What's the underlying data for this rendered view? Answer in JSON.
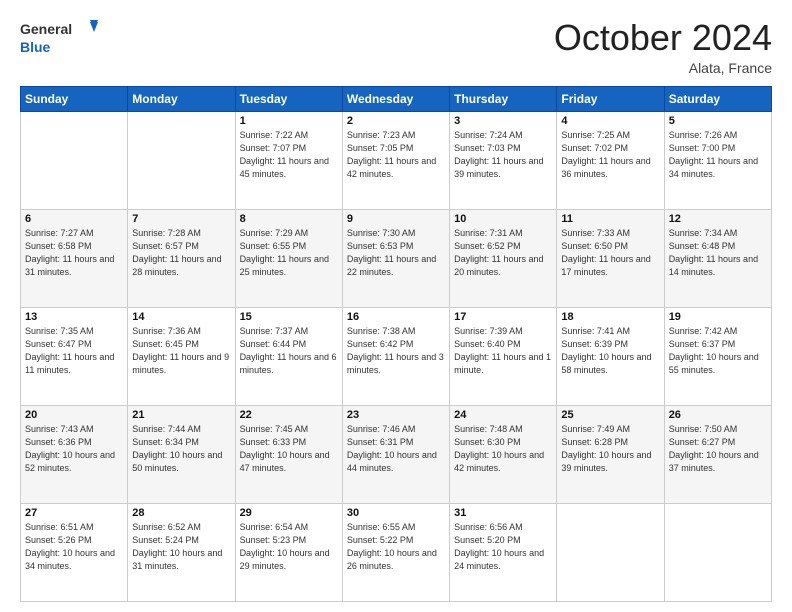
{
  "header": {
    "logo_general": "General",
    "logo_blue": "Blue",
    "month": "October 2024",
    "location": "Alata, France"
  },
  "weekdays": [
    "Sunday",
    "Monday",
    "Tuesday",
    "Wednesday",
    "Thursday",
    "Friday",
    "Saturday"
  ],
  "weeks": [
    [
      {
        "day": "",
        "sunrise": "",
        "sunset": "",
        "daylight": ""
      },
      {
        "day": "",
        "sunrise": "",
        "sunset": "",
        "daylight": ""
      },
      {
        "day": "1",
        "sunrise": "Sunrise: 7:22 AM",
        "sunset": "Sunset: 7:07 PM",
        "daylight": "Daylight: 11 hours and 45 minutes."
      },
      {
        "day": "2",
        "sunrise": "Sunrise: 7:23 AM",
        "sunset": "Sunset: 7:05 PM",
        "daylight": "Daylight: 11 hours and 42 minutes."
      },
      {
        "day": "3",
        "sunrise": "Sunrise: 7:24 AM",
        "sunset": "Sunset: 7:03 PM",
        "daylight": "Daylight: 11 hours and 39 minutes."
      },
      {
        "day": "4",
        "sunrise": "Sunrise: 7:25 AM",
        "sunset": "Sunset: 7:02 PM",
        "daylight": "Daylight: 11 hours and 36 minutes."
      },
      {
        "day": "5",
        "sunrise": "Sunrise: 7:26 AM",
        "sunset": "Sunset: 7:00 PM",
        "daylight": "Daylight: 11 hours and 34 minutes."
      }
    ],
    [
      {
        "day": "6",
        "sunrise": "Sunrise: 7:27 AM",
        "sunset": "Sunset: 6:58 PM",
        "daylight": "Daylight: 11 hours and 31 minutes."
      },
      {
        "day": "7",
        "sunrise": "Sunrise: 7:28 AM",
        "sunset": "Sunset: 6:57 PM",
        "daylight": "Daylight: 11 hours and 28 minutes."
      },
      {
        "day": "8",
        "sunrise": "Sunrise: 7:29 AM",
        "sunset": "Sunset: 6:55 PM",
        "daylight": "Daylight: 11 hours and 25 minutes."
      },
      {
        "day": "9",
        "sunrise": "Sunrise: 7:30 AM",
        "sunset": "Sunset: 6:53 PM",
        "daylight": "Daylight: 11 hours and 22 minutes."
      },
      {
        "day": "10",
        "sunrise": "Sunrise: 7:31 AM",
        "sunset": "Sunset: 6:52 PM",
        "daylight": "Daylight: 11 hours and 20 minutes."
      },
      {
        "day": "11",
        "sunrise": "Sunrise: 7:33 AM",
        "sunset": "Sunset: 6:50 PM",
        "daylight": "Daylight: 11 hours and 17 minutes."
      },
      {
        "day": "12",
        "sunrise": "Sunrise: 7:34 AM",
        "sunset": "Sunset: 6:48 PM",
        "daylight": "Daylight: 11 hours and 14 minutes."
      }
    ],
    [
      {
        "day": "13",
        "sunrise": "Sunrise: 7:35 AM",
        "sunset": "Sunset: 6:47 PM",
        "daylight": "Daylight: 11 hours and 11 minutes."
      },
      {
        "day": "14",
        "sunrise": "Sunrise: 7:36 AM",
        "sunset": "Sunset: 6:45 PM",
        "daylight": "Daylight: 11 hours and 9 minutes."
      },
      {
        "day": "15",
        "sunrise": "Sunrise: 7:37 AM",
        "sunset": "Sunset: 6:44 PM",
        "daylight": "Daylight: 11 hours and 6 minutes."
      },
      {
        "day": "16",
        "sunrise": "Sunrise: 7:38 AM",
        "sunset": "Sunset: 6:42 PM",
        "daylight": "Daylight: 11 hours and 3 minutes."
      },
      {
        "day": "17",
        "sunrise": "Sunrise: 7:39 AM",
        "sunset": "Sunset: 6:40 PM",
        "daylight": "Daylight: 11 hours and 1 minute."
      },
      {
        "day": "18",
        "sunrise": "Sunrise: 7:41 AM",
        "sunset": "Sunset: 6:39 PM",
        "daylight": "Daylight: 10 hours and 58 minutes."
      },
      {
        "day": "19",
        "sunrise": "Sunrise: 7:42 AM",
        "sunset": "Sunset: 6:37 PM",
        "daylight": "Daylight: 10 hours and 55 minutes."
      }
    ],
    [
      {
        "day": "20",
        "sunrise": "Sunrise: 7:43 AM",
        "sunset": "Sunset: 6:36 PM",
        "daylight": "Daylight: 10 hours and 52 minutes."
      },
      {
        "day": "21",
        "sunrise": "Sunrise: 7:44 AM",
        "sunset": "Sunset: 6:34 PM",
        "daylight": "Daylight: 10 hours and 50 minutes."
      },
      {
        "day": "22",
        "sunrise": "Sunrise: 7:45 AM",
        "sunset": "Sunset: 6:33 PM",
        "daylight": "Daylight: 10 hours and 47 minutes."
      },
      {
        "day": "23",
        "sunrise": "Sunrise: 7:46 AM",
        "sunset": "Sunset: 6:31 PM",
        "daylight": "Daylight: 10 hours and 44 minutes."
      },
      {
        "day": "24",
        "sunrise": "Sunrise: 7:48 AM",
        "sunset": "Sunset: 6:30 PM",
        "daylight": "Daylight: 10 hours and 42 minutes."
      },
      {
        "day": "25",
        "sunrise": "Sunrise: 7:49 AM",
        "sunset": "Sunset: 6:28 PM",
        "daylight": "Daylight: 10 hours and 39 minutes."
      },
      {
        "day": "26",
        "sunrise": "Sunrise: 7:50 AM",
        "sunset": "Sunset: 6:27 PM",
        "daylight": "Daylight: 10 hours and 37 minutes."
      }
    ],
    [
      {
        "day": "27",
        "sunrise": "Sunrise: 6:51 AM",
        "sunset": "Sunset: 5:26 PM",
        "daylight": "Daylight: 10 hours and 34 minutes."
      },
      {
        "day": "28",
        "sunrise": "Sunrise: 6:52 AM",
        "sunset": "Sunset: 5:24 PM",
        "daylight": "Daylight: 10 hours and 31 minutes."
      },
      {
        "day": "29",
        "sunrise": "Sunrise: 6:54 AM",
        "sunset": "Sunset: 5:23 PM",
        "daylight": "Daylight: 10 hours and 29 minutes."
      },
      {
        "day": "30",
        "sunrise": "Sunrise: 6:55 AM",
        "sunset": "Sunset: 5:22 PM",
        "daylight": "Daylight: 10 hours and 26 minutes."
      },
      {
        "day": "31",
        "sunrise": "Sunrise: 6:56 AM",
        "sunset": "Sunset: 5:20 PM",
        "daylight": "Daylight: 10 hours and 24 minutes."
      },
      {
        "day": "",
        "sunrise": "",
        "sunset": "",
        "daylight": ""
      },
      {
        "day": "",
        "sunrise": "",
        "sunset": "",
        "daylight": ""
      }
    ]
  ]
}
